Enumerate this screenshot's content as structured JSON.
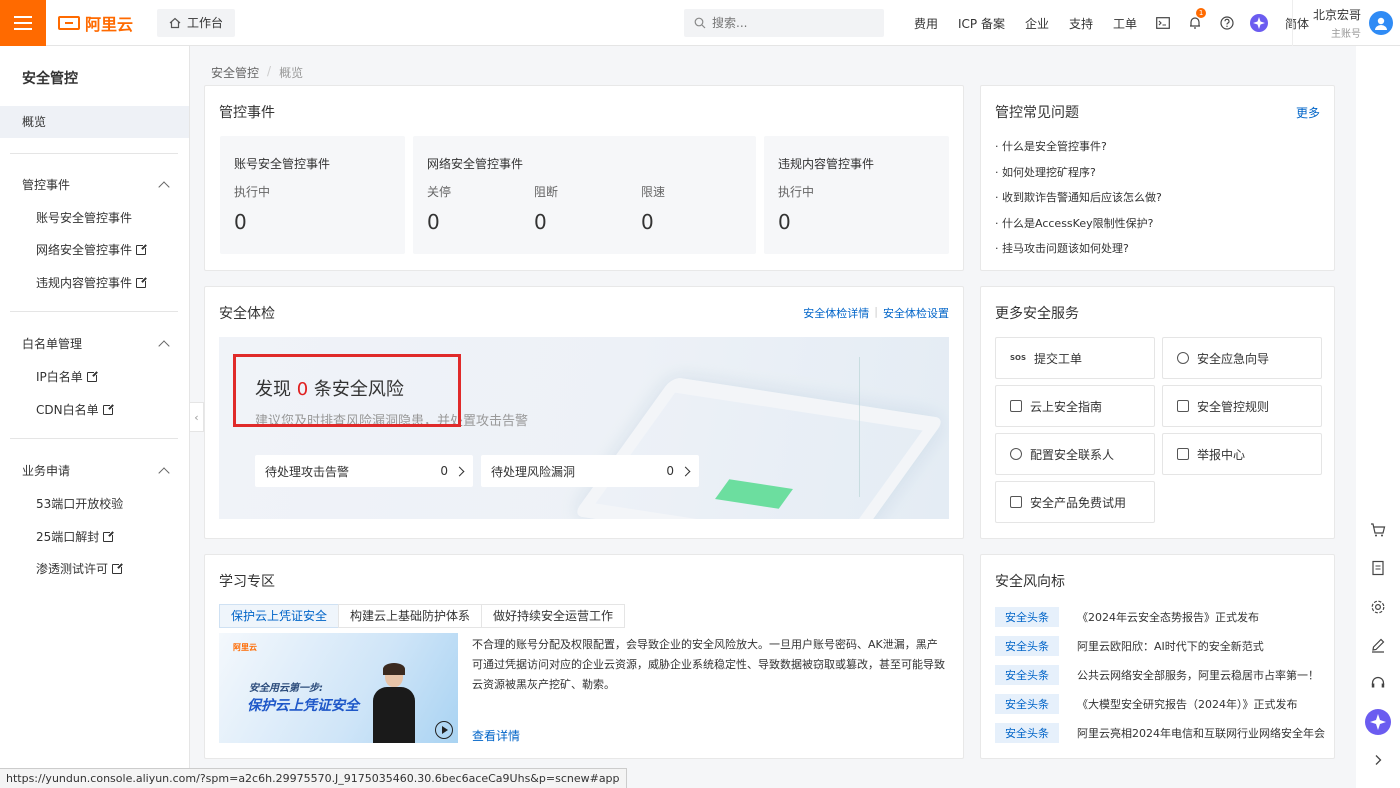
{
  "topbar": {
    "brand": "阿里云",
    "workbench": "工作台",
    "search_placeholder": "搜索...",
    "nav": [
      "费用",
      "ICP 备案",
      "企业",
      "支持",
      "工单"
    ],
    "notification_count": "1",
    "language": "简体",
    "user_name": "北京宏哥",
    "user_sub": "主账号"
  },
  "sidebar": {
    "title": "安全管控",
    "active": "概览",
    "groups": [
      {
        "label": "管控事件",
        "items": [
          "账号安全管控事件",
          "网络安全管控事件",
          "违规内容管控事件"
        ]
      },
      {
        "label": "白名单管理",
        "items": [
          "IP白名单",
          "CDN白名单"
        ]
      },
      {
        "label": "业务申请",
        "items": [
          "53端口开放校验",
          "25端口解封",
          "渗透测试许可"
        ]
      }
    ]
  },
  "breadcrumb": {
    "root": "安全管控",
    "sep": "/",
    "current": "概览"
  },
  "events": {
    "title": "管控事件",
    "account": {
      "title": "账号安全管控事件",
      "label": "执行中",
      "value": "0"
    },
    "network": {
      "title": "网络安全管控事件",
      "cols": [
        {
          "label": "关停",
          "value": "0"
        },
        {
          "label": "阻断",
          "value": "0"
        },
        {
          "label": "限速",
          "value": "0"
        }
      ]
    },
    "content": {
      "title": "违规内容管控事件",
      "label": "执行中",
      "value": "0"
    }
  },
  "checkup": {
    "title": "安全体检",
    "link_detail": "安全体检详情",
    "link_sep": "|",
    "link_settings": "安全体检设置",
    "risk_prefix": "发现",
    "risk_count": "0",
    "risk_suffix": "条安全风险",
    "risk_sub": "建议您及时排查风险漏洞隐患，并处置攻击告警",
    "pending_attack": {
      "label": "待处理攻击告警",
      "count": "0"
    },
    "pending_vuln": {
      "label": "待处理风险漏洞",
      "count": "0"
    }
  },
  "faq": {
    "title": "管控常见问题",
    "more": "更多",
    "items": [
      "什么是安全管控事件?",
      "如何处理挖矿程序?",
      "收到欺诈告警通知后应该怎么做?",
      "什么是AccessKey限制性保护?",
      "挂马攻击问题该如何处理?"
    ]
  },
  "services": {
    "title": "更多安全服务",
    "items": [
      "提交工单",
      "安全应急向导",
      "云上安全指南",
      "安全管控规则",
      "配置安全联系人",
      "举报中心",
      "安全产品免费试用"
    ],
    "sos_label": "SOS"
  },
  "learn": {
    "title": "学习专区",
    "tabs": [
      "保护云上凭证安全",
      "构建云上基础防护体系",
      "做好持续安全运营工作"
    ],
    "video_brand": "阿里云",
    "video_line1": "安全用云第一步:",
    "video_line2": "保护云上凭证安全",
    "text": "不合理的账号分配及权限配置，会导致企业的安全风险放大。一旦用户账号密码、AK泄漏，黑产可通过凭据访问对应的企业云资源，威胁企业系统稳定性、导致数据被窃取或篡改，甚至可能导致云资源被黑灰产挖矿、勒索。",
    "more": "查看详情"
  },
  "news": {
    "title": "安全风向标",
    "tag": "安全头条",
    "items": [
      "《2024年云安全态势报告》正式发布",
      "阿里云欧阳欣：AI时代下的安全新范式",
      "公共云网络安全部服务，阿里云稳居市占率第一！",
      "《大模型安全研究报告（2024年）》正式发布",
      "阿里云亮相2024年电信和互联网行业网络安全年会"
    ]
  },
  "statusbar": {
    "url": "https://yundun.console.aliyun.com/?spm=a2c6h.29975570.J_9175035460.30.6bec6aceCa9Uhs&p=scnew#app"
  },
  "colors": {
    "brand": "#ff6a00",
    "link": "#0064c8",
    "danger": "#e02020"
  }
}
